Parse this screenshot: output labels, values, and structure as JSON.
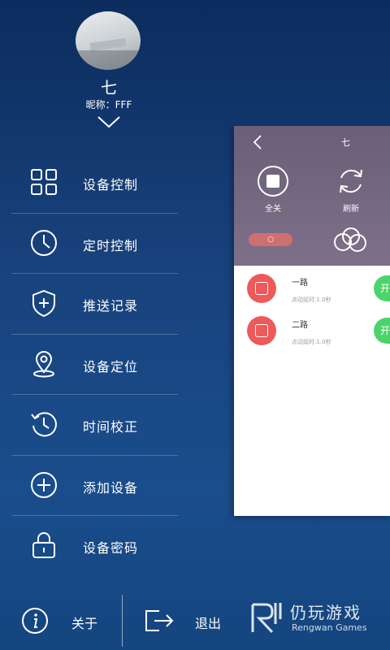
{
  "profile": {
    "nickname": "七",
    "nickname_line": "昵称：FFF"
  },
  "menu": {
    "items": [
      {
        "label": "设备控制",
        "icon": "grid-icon"
      },
      {
        "label": "定时控制",
        "icon": "clock-icon"
      },
      {
        "label": "推送记录",
        "icon": "shield-plus-icon"
      },
      {
        "label": "设备定位",
        "icon": "location-pin-icon"
      },
      {
        "label": "时间校正",
        "icon": "history-icon"
      },
      {
        "label": "添加设备",
        "icon": "plus-circle-icon"
      },
      {
        "label": "设备密码",
        "icon": "lock-icon"
      }
    ]
  },
  "footer": {
    "about_label": "关于",
    "exit_label": "退出"
  },
  "card": {
    "title": "七",
    "all_off_label": "全关",
    "refresh_label": "刷新",
    "pill_label": "○",
    "channels": [
      {
        "name": "一路",
        "delay": "点动延时:1.0秒",
        "toggle_label": "开"
      },
      {
        "name": "二路",
        "delay": "点动延时:1.0秒",
        "toggle_label": "开"
      }
    ]
  },
  "watermark": {
    "cn": "仍玩游戏",
    "en": "Rengwan Games"
  }
}
